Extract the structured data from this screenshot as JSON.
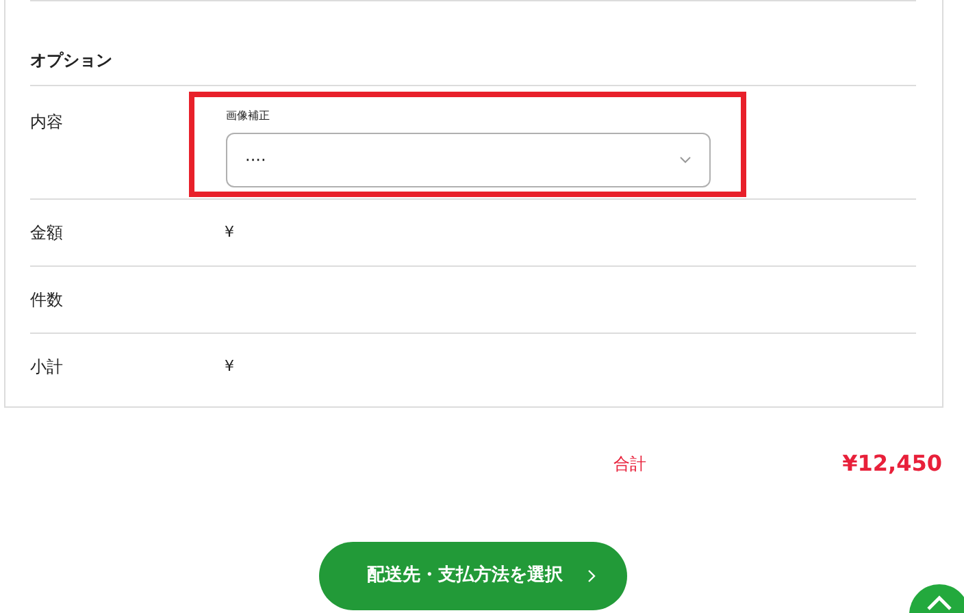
{
  "section_title": "オプション",
  "rows": [
    {
      "kind": "select",
      "label": "内容",
      "highlighted": true,
      "field_label": "画像補正",
      "value": "····"
    },
    {
      "kind": "text",
      "label": "金額",
      "value": "¥"
    },
    {
      "kind": "text",
      "label": "件数"
    },
    {
      "kind": "text",
      "label": "小計",
      "value": "¥"
    }
  ],
  "total": {
    "label": "合計",
    "value": "¥12,450"
  },
  "submit_button": "配送先・支払方法を選択"
}
